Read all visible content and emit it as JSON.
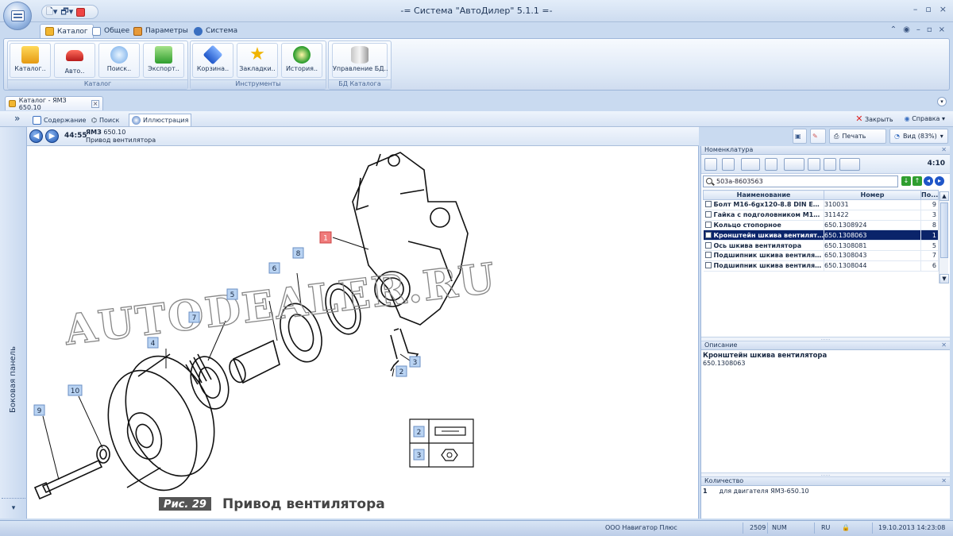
{
  "window": {
    "title": "-= Система \"АвтоДилер\" 5.1.1 =-",
    "controls": [
      "–",
      "▫",
      "×"
    ]
  },
  "ribbon_tabs": [
    "Каталог",
    "Общее",
    "Параметры",
    "Система"
  ],
  "ribbon_groups": [
    {
      "label": "Каталог",
      "buttons": [
        "Каталог..",
        "Авто..",
        "Поиск..",
        "Экспорт.."
      ]
    },
    {
      "label": "Инструменты",
      "buttons": [
        "Корзина..",
        "Закладки..",
        "История.."
      ]
    },
    {
      "label": "БД Каталога",
      "buttons": [
        "Управление БД.."
      ]
    }
  ],
  "doc_tab": {
    "label": "Каталог - ЯМЗ  650.10"
  },
  "sub_tabs": [
    "Содержание",
    "Поиск",
    "Иллюстрация"
  ],
  "sub_actions": {
    "close": "Закрыть",
    "help": "Справка"
  },
  "sidepanel": {
    "label": "Боковая панель"
  },
  "illustration": {
    "time": "44:55",
    "model_bold": "ЯМЗ",
    "model": "650.10",
    "subtitle": "Привод вентилятора",
    "print": "Печать",
    "view": "Вид (83%)",
    "watermark": "AUTODEALER.RU",
    "caption_prefix": "Рис. 29",
    "caption": "Привод вентилятора",
    "callouts": [
      "1",
      "2",
      "3",
      "4",
      "5",
      "6",
      "7",
      "8",
      "9",
      "10"
    ],
    "legend": [
      "2",
      "3"
    ]
  },
  "nomenclature": {
    "title": "Номенклатура",
    "count": "4:10",
    "search_value": "503а-8603563",
    "columns": [
      "Наименование",
      "Номер",
      "По..."
    ],
    "rows": [
      {
        "name": "Болт M16-6gx120-8.8 DIN EN I...",
        "number": "310031",
        "qty": "9"
      },
      {
        "name": "Гайка с подголовником M10x...",
        "number": "311422",
        "qty": "3"
      },
      {
        "name": "Кольцо стопорное",
        "number": "650.1308924",
        "qty": "8"
      },
      {
        "name": "Кронштейн шкива вентилято...",
        "number": "650.1308063",
        "qty": "1",
        "selected": true
      },
      {
        "name": "Ось шкива вентилятора",
        "number": "650.1308081",
        "qty": "5"
      },
      {
        "name": "Подшипник шкива вентилято...",
        "number": "650.1308043",
        "qty": "7"
      },
      {
        "name": "Подшипник шкива вентилято...",
        "number": "650.1308044",
        "qty": "6"
      }
    ]
  },
  "description": {
    "title": "Описание",
    "name": "Кронштейн шкива вентилятора",
    "number": "650.1308063"
  },
  "quantity": {
    "title": "Количество",
    "num": "1",
    "text": "для двигателя ЯМЗ-650.10"
  },
  "status": {
    "company": "ООО Навигатор Плюс",
    "code": "2509",
    "num": "NUM",
    "lang": "RU",
    "datetime": "19.10.2013 14:23:08"
  }
}
